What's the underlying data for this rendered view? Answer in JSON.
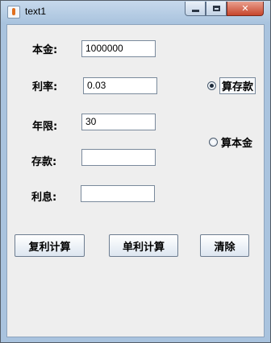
{
  "window": {
    "title": "text1",
    "controls": {
      "minimize": "",
      "maximize": "",
      "close": "✕"
    }
  },
  "form": {
    "principal": {
      "label": "本金:",
      "value": "1000000"
    },
    "rate": {
      "label": "利率:",
      "value": "0.03"
    },
    "years": {
      "label": "年限:",
      "value": "30"
    },
    "deposit": {
      "label": "存款:",
      "value": ""
    },
    "interest": {
      "label": "利息:",
      "value": ""
    }
  },
  "mode": {
    "options": [
      {
        "label": "算存款",
        "selected": true
      },
      {
        "label": "算本金",
        "selected": false
      }
    ]
  },
  "buttons": {
    "compound": "复利计算",
    "simple": "单利计算",
    "clear": "清除"
  }
}
